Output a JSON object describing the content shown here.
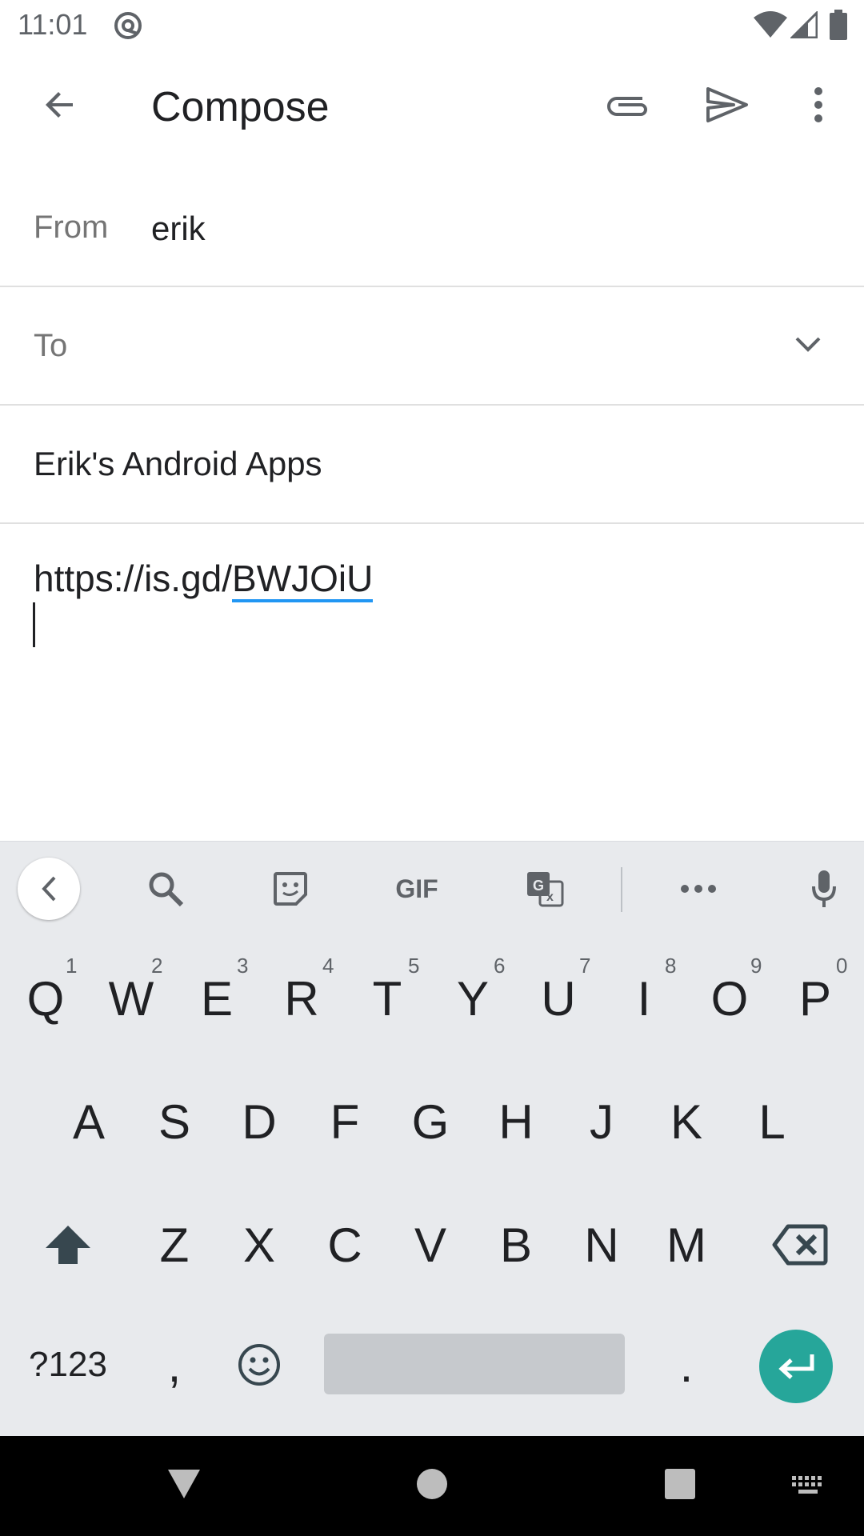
{
  "status_bar": {
    "time": "11:01"
  },
  "app_bar": {
    "title": "Compose"
  },
  "from": {
    "label": "From",
    "value": "erik"
  },
  "to": {
    "label": "To",
    "value": ""
  },
  "subject": {
    "value": "Erik's Android Apps"
  },
  "body": {
    "text_prefix": "https://is.gd/",
    "link_text": "BWJOiU"
  },
  "keyboard": {
    "toolbar": {
      "gif_label": "GIF"
    },
    "row1": [
      {
        "label": "Q",
        "hint": "1"
      },
      {
        "label": "W",
        "hint": "2"
      },
      {
        "label": "E",
        "hint": "3"
      },
      {
        "label": "R",
        "hint": "4"
      },
      {
        "label": "T",
        "hint": "5"
      },
      {
        "label": "Y",
        "hint": "6"
      },
      {
        "label": "U",
        "hint": "7"
      },
      {
        "label": "I",
        "hint": "8"
      },
      {
        "label": "O",
        "hint": "9"
      },
      {
        "label": "P",
        "hint": "0"
      }
    ],
    "row2": [
      "A",
      "S",
      "D",
      "F",
      "G",
      "H",
      "J",
      "K",
      "L"
    ],
    "row3": [
      "Z",
      "X",
      "C",
      "V",
      "B",
      "N",
      "M"
    ],
    "symbols_label": "?123",
    "comma_label": ",",
    "period_label": "."
  },
  "colors": {
    "accent": "#26a69a",
    "link_underline": "#2196f3",
    "keyboard_bg": "#e8eaed"
  }
}
